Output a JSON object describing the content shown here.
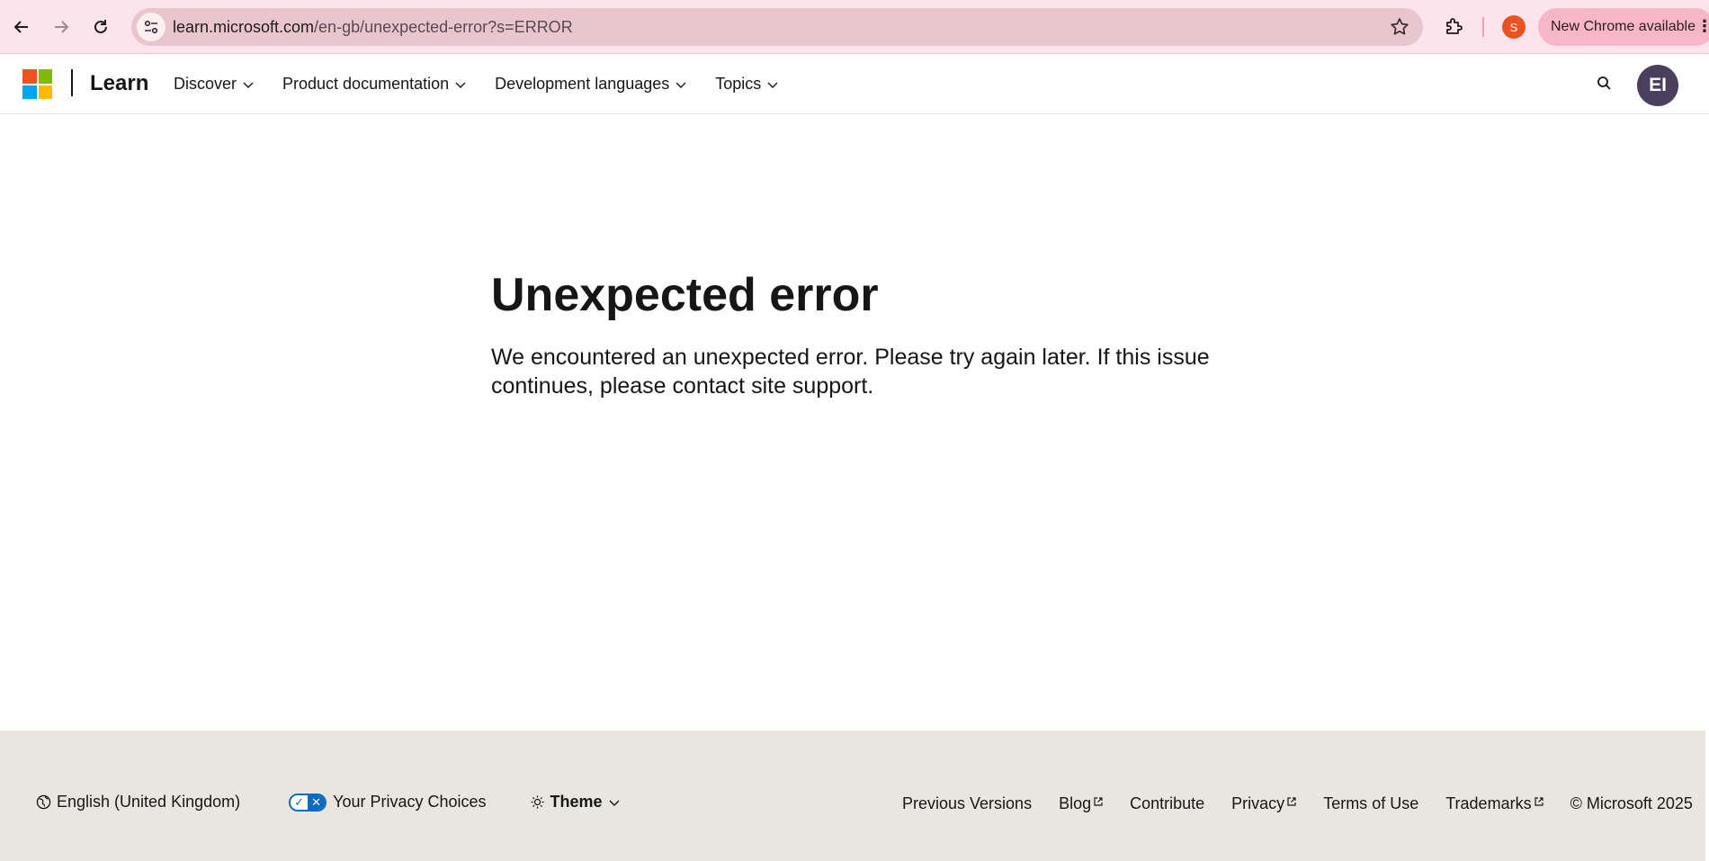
{
  "browser": {
    "url_host": "learn.microsoft.com",
    "url_path": "/en-gb/unexpected-error?s=ERROR",
    "profile_initial": "S",
    "update_label": "New Chrome available",
    "menu_glyph": "⋮",
    "icons": [
      "back-icon",
      "forward-icon",
      "reload-icon",
      "site-info-icon",
      "star-icon",
      "extensions-icon"
    ],
    "colors": {
      "bar": "#fce4ec",
      "omnibox": "#e9c6cf",
      "update_pill": "#f8b7c8",
      "profile": "#e8531f"
    }
  },
  "header": {
    "brand": "Learn",
    "nav": [
      {
        "label": "Discover"
      },
      {
        "label": "Product documentation"
      },
      {
        "label": "Development languages"
      },
      {
        "label": "Topics"
      }
    ],
    "avatar_initials": "EI",
    "colors": {
      "avatar": "#4b3f5e"
    }
  },
  "main": {
    "title": "Unexpected error",
    "message": "We encountered an unexpected error. Please try again later. If this issue continues, please contact site support."
  },
  "footer": {
    "locale": "English (United Kingdom)",
    "privacy_choices": "Your Privacy Choices",
    "theme": "Theme",
    "links": [
      {
        "label": "Previous Versions",
        "external": false
      },
      {
        "label": "Blog",
        "external": true
      },
      {
        "label": "Contribute",
        "external": false
      },
      {
        "label": "Privacy",
        "external": true
      },
      {
        "label": "Terms of Use",
        "external": false
      },
      {
        "label": "Trademarks",
        "external": true
      }
    ],
    "copyright": "© Microsoft 2025",
    "colors": {
      "background": "#e8e6df",
      "toggle": "#0f6cbd"
    }
  }
}
